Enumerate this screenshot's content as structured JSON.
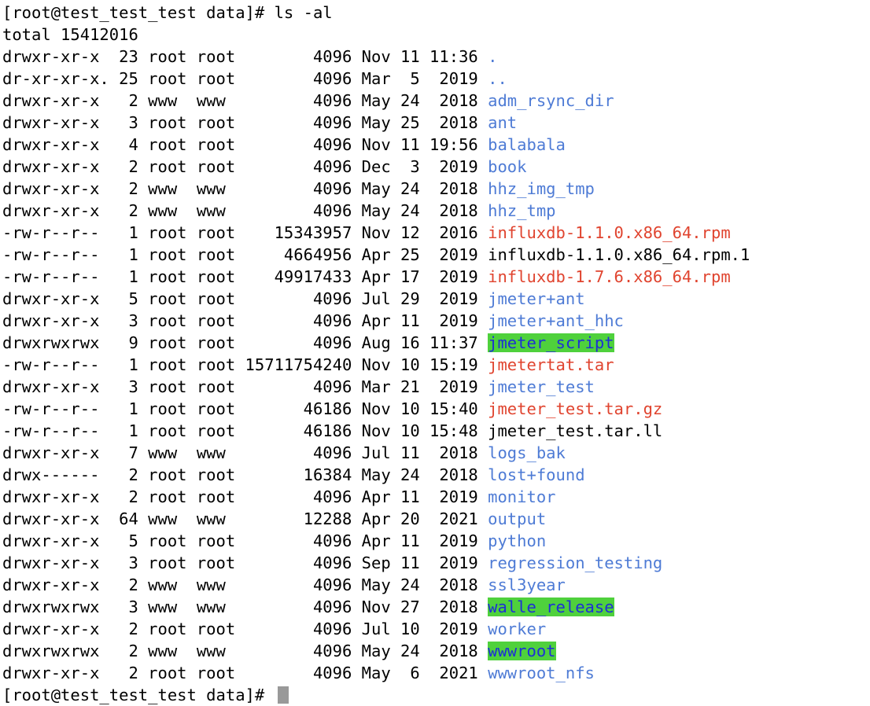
{
  "prompt": "[root@test_test_test data]# ",
  "command": "ls -al",
  "total_line": "total 15412016",
  "colors": {
    "background": "#ffffff",
    "text": "#000000",
    "directory": "#4e7bd5",
    "archive": "#e0442f",
    "sticky_bg": "#4fd13c",
    "sticky_fg": "#1d2fd6",
    "cursor": "#999999"
  },
  "entries": [
    {
      "meta": "drwxr-xr-x  23 root root        4096 Nov 11 11:36 ",
      "name": ".",
      "kind": "dir"
    },
    {
      "meta": "dr-xr-xr-x. 25 root root        4096 Mar  5  2019 ",
      "name": "..",
      "kind": "dir"
    },
    {
      "meta": "drwxr-xr-x   2 www  www         4096 May 24  2018 ",
      "name": "adm_rsync_dir",
      "kind": "dir"
    },
    {
      "meta": "drwxr-xr-x   3 root root        4096 May 25  2018 ",
      "name": "ant",
      "kind": "dir"
    },
    {
      "meta": "drwxr-xr-x   4 root root        4096 Nov 11 19:56 ",
      "name": "balabala",
      "kind": "dir"
    },
    {
      "meta": "drwxr-xr-x   2 root root        4096 Dec  3  2019 ",
      "name": "book",
      "kind": "dir"
    },
    {
      "meta": "drwxr-xr-x   2 www  www         4096 May 24  2018 ",
      "name": "hhz_img_tmp",
      "kind": "dir"
    },
    {
      "meta": "drwxr-xr-x   2 www  www         4096 May 24  2018 ",
      "name": "hhz_tmp",
      "kind": "dir"
    },
    {
      "meta": "-rw-r--r--   1 root root    15343957 Nov 12  2016 ",
      "name": "influxdb-1.1.0.x86_64.rpm",
      "kind": "archive"
    },
    {
      "meta": "-rw-r--r--   1 root root     4664956 Apr 25  2019 ",
      "name": "influxdb-1.1.0.x86_64.rpm.1",
      "kind": "file"
    },
    {
      "meta": "-rw-r--r--   1 root root    49917433 Apr 17  2019 ",
      "name": "influxdb-1.7.6.x86_64.rpm",
      "kind": "archive"
    },
    {
      "meta": "drwxr-xr-x   5 root root        4096 Jul 29  2019 ",
      "name": "jmeter+ant",
      "kind": "dir"
    },
    {
      "meta": "drwxr-xr-x   3 root root        4096 Apr 11  2019 ",
      "name": "jmeter+ant_hhc",
      "kind": "dir"
    },
    {
      "meta": "drwxrwxrwx   9 root root        4096 Aug 16 11:37 ",
      "name": "jmeter_script",
      "kind": "sticky"
    },
    {
      "meta": "-rw-r--r--   1 root root 15711754240 Nov 10 15:19 ",
      "name": "jmetertat.tar",
      "kind": "archive"
    },
    {
      "meta": "drwxr-xr-x   3 root root        4096 Mar 21  2019 ",
      "name": "jmeter_test",
      "kind": "dir"
    },
    {
      "meta": "-rw-r--r--   1 root root       46186 Nov 10 15:40 ",
      "name": "jmeter_test.tar.gz",
      "kind": "archive"
    },
    {
      "meta": "-rw-r--r--   1 root root       46186 Nov 10 15:48 ",
      "name": "jmeter_test.tar.ll",
      "kind": "file"
    },
    {
      "meta": "drwxr-xr-x   7 www  www         4096 Jul 11  2018 ",
      "name": "logs_bak",
      "kind": "dir"
    },
    {
      "meta": "drwx------   2 root root       16384 May 24  2018 ",
      "name": "lost+found",
      "kind": "dir"
    },
    {
      "meta": "drwxr-xr-x   2 root root        4096 Apr 11  2019 ",
      "name": "monitor",
      "kind": "dir"
    },
    {
      "meta": "drwxr-xr-x  64 www  www        12288 Apr 20  2021 ",
      "name": "output",
      "kind": "dir"
    },
    {
      "meta": "drwxr-xr-x   5 root root        4096 Apr 11  2019 ",
      "name": "python",
      "kind": "dir"
    },
    {
      "meta": "drwxr-xr-x   3 root root        4096 Sep 11  2019 ",
      "name": "regression_testing",
      "kind": "dir"
    },
    {
      "meta": "drwxr-xr-x   2 www  www         4096 May 24  2018 ",
      "name": "ssl3year",
      "kind": "dir"
    },
    {
      "meta": "drwxrwxrwx   3 www  www         4096 Nov 27  2018 ",
      "name": "walle_release",
      "kind": "sticky"
    },
    {
      "meta": "drwxr-xr-x   2 root root        4096 Jul 10  2019 ",
      "name": "worker",
      "kind": "dir"
    },
    {
      "meta": "drwxrwxrwx   2 www  www         4096 May 24  2018 ",
      "name": "wwwroot",
      "kind": "sticky"
    },
    {
      "meta": "drwxr-xr-x   2 root root        4096 May  6  2021 ",
      "name": "wwwroot_nfs",
      "kind": "dir"
    }
  ],
  "cursor_icon": "block-cursor"
}
